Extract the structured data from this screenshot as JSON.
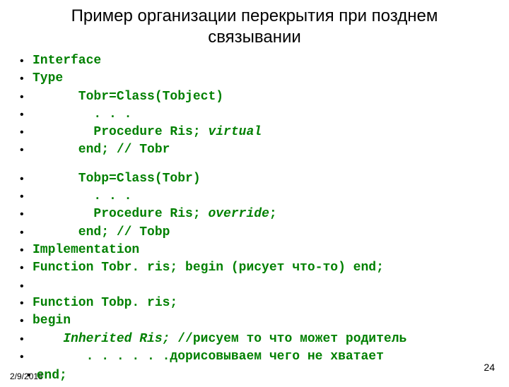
{
  "title": "Пример организации перекрытия при позднем связывании",
  "lines": [
    {
      "text": "Interface"
    },
    {
      "text": "Type"
    },
    {
      "text": "      Tobr=Class(Tobject)"
    },
    {
      "text": "        . . ."
    },
    {
      "text": "        Procedure Ris; ",
      "suffix_italic": "virtual"
    },
    {
      "text": "      end; // Tobr"
    },
    {
      "gap": true
    },
    {
      "text": "      Tobp=Class(Tobr)"
    },
    {
      "text": "        . . ."
    },
    {
      "text": "        Procedure Ris; ",
      "suffix_italic": "override",
      "after_italic": ";"
    },
    {
      "text": "      end; // Tobp"
    },
    {
      "text": "Implementation"
    },
    {
      "text": "Function Tobr. ris; begin (рисует что-то) end;"
    },
    {
      "text": ""
    },
    {
      "text": "Function Tobp. ris;"
    },
    {
      "text": "begin"
    },
    {
      "text": "    ",
      "italic_lead": "Inherited Ris;",
      "after_italic": " //рисуем то что может родитель"
    },
    {
      "text": "       . . . . . .дорисовываем чего не хватает"
    }
  ],
  "end_line": "end;",
  "footer_date": "2/9/2018",
  "footer_page": "24"
}
